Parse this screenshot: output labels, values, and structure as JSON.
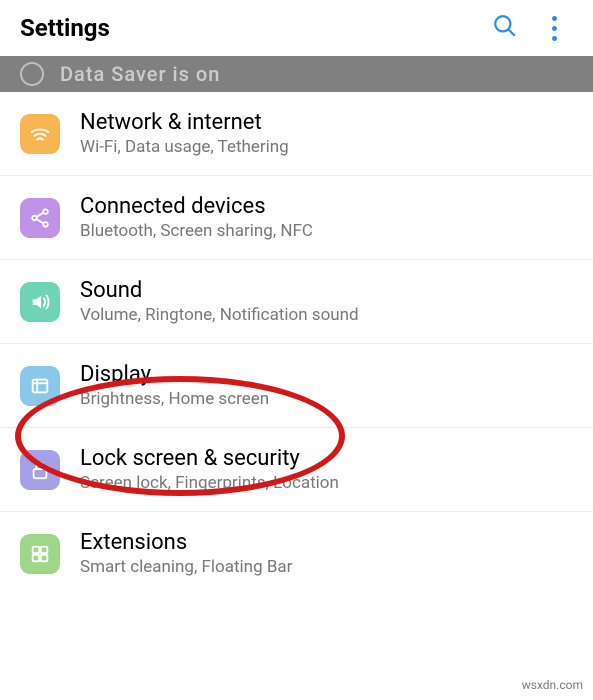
{
  "header": {
    "title": "Settings"
  },
  "banner": {
    "text": "Data Saver is on"
  },
  "items": [
    {
      "title": "Network & internet",
      "subtitle": "Wi-Fi, Data usage, Tethering"
    },
    {
      "title": "Connected devices",
      "subtitle": "Bluetooth, Screen sharing, NFC"
    },
    {
      "title": "Sound",
      "subtitle": "Volume, Ringtone, Notification sound"
    },
    {
      "title": "Display",
      "subtitle": "Brightness, Home screen"
    },
    {
      "title": "Lock screen & security",
      "subtitle": "Screen lock, Fingerprints, Location"
    },
    {
      "title": "Extensions",
      "subtitle": "Smart cleaning, Floating Bar"
    }
  ],
  "watermark": "wsxdn.com"
}
